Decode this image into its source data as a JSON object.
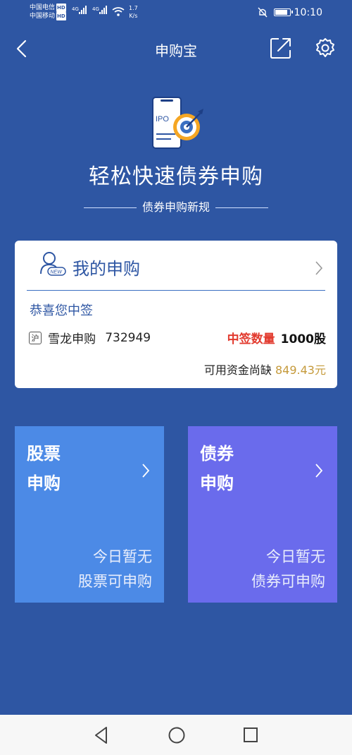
{
  "status_bar": {
    "carrier1": "中国电信",
    "carrier2": "中国移动",
    "hd_badge": "HD",
    "network1": "4G",
    "network2": "4G",
    "net_speed_value": "1.7",
    "net_speed_unit": "K/s",
    "time": "10:10",
    "battery_level": 0.9
  },
  "header": {
    "title": "申购宝"
  },
  "hero": {
    "icon_text": "IPO",
    "title": "轻松快速债券申购",
    "subtitle": "债券申购新规"
  },
  "my_subscription": {
    "title": "我的申购",
    "badge": "NEW",
    "congrats": "恭喜您中签",
    "market_badge": "沪",
    "stock_name": "雪龙申购",
    "stock_code": "732949",
    "qty_label": "中签数量",
    "qty_value": "1000股",
    "funds_label": "可用资金尚缺",
    "funds_amount": "849.43元"
  },
  "tiles": {
    "stock": {
      "title_line1": "股票",
      "title_line2": "申购",
      "desc_line1": "今日暂无",
      "desc_line2": "股票可申购"
    },
    "bond": {
      "title_line1": "债券",
      "title_line2": "申购",
      "desc_line1": "今日暂无",
      "desc_line2": "债券可申购"
    }
  },
  "colors": {
    "background": "#2e56a3",
    "stock_tile": "#4c8ae6",
    "bond_tile": "#6a6bec",
    "highlight_red": "#e23a2e",
    "funds_gold": "#c59a3b"
  },
  "icons": [
    "back-icon",
    "share-icon",
    "settings-icon",
    "ipo-target-icon",
    "user-new-icon",
    "chevron-right-icon",
    "nav-back-icon",
    "nav-home-icon",
    "nav-recents-icon"
  ]
}
